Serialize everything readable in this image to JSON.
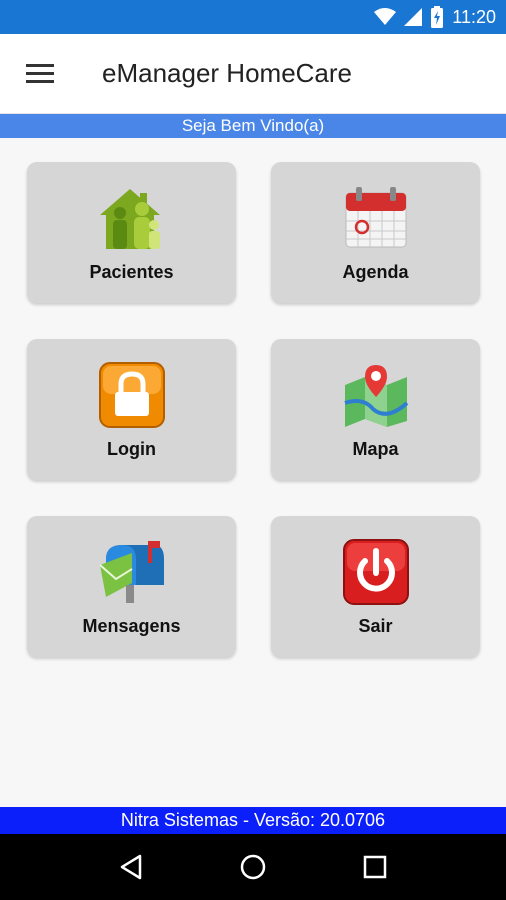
{
  "status_bar": {
    "time": "11:20",
    "icons": [
      "wifi-icon",
      "signal-icon",
      "battery-charging-icon"
    ]
  },
  "app_bar": {
    "title": "eManager HomeCare",
    "menu_icon": "hamburger-menu-icon"
  },
  "welcome": {
    "text": "Seja Bem Vindo(a)"
  },
  "tiles": [
    {
      "label": "Pacientes",
      "icon": "family-house-icon"
    },
    {
      "label": "Agenda",
      "icon": "calendar-icon"
    },
    {
      "label": "Login",
      "icon": "padlock-icon"
    },
    {
      "label": "Mapa",
      "icon": "map-pin-icon"
    },
    {
      "label": "Mensagens",
      "icon": "mailbox-icon"
    },
    {
      "label": "Sair",
      "icon": "power-icon"
    }
  ],
  "footer": {
    "text": "Nitra Sistemas - Versão: 20.0706"
  },
  "nav_bar": {
    "icons": [
      "back-icon",
      "home-icon",
      "recents-icon"
    ]
  },
  "colors": {
    "status_bar": "#1976d2",
    "welcome_bar": "#4a86e8",
    "footer": "#0b1ffa",
    "tile": "#d6d6d6"
  }
}
